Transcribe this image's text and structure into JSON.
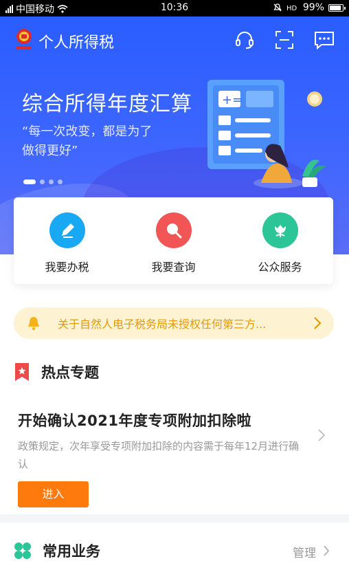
{
  "status_bar": {
    "carrier": "中国移动",
    "time": "10:36",
    "battery": "99%"
  },
  "header": {
    "app_title": "个人所得税",
    "logo_icon": "tax-emblem-icon",
    "buttons": [
      "headset-icon",
      "scan-icon",
      "message-icon"
    ]
  },
  "banner": {
    "title": "综合所得年度汇算",
    "subtitle_line1": "“每一次改变，都是为了",
    "subtitle_line2": "做得更好”",
    "slides": 4,
    "active_slide": 1
  },
  "quick_actions": [
    {
      "label": "我要办税",
      "icon": "pencil-icon",
      "color": "#19a8f4"
    },
    {
      "label": "我要查询",
      "icon": "search-icon",
      "color": "#f25555"
    },
    {
      "label": "公众服务",
      "icon": "tulip-icon",
      "color": "#2cc597"
    }
  ],
  "notice": {
    "text": "关于自然人电子税务局未授权任何第三方...",
    "color": "#e59a00",
    "background": "#fdf3d3"
  },
  "hot_topics": {
    "title": "热点专题",
    "topic": {
      "title": "开始确认2021年度专项附加扣除啦",
      "description": "政策规定，次年享受专项附加扣除的内容需于每年12月进行确认",
      "button": "进入"
    }
  },
  "common_services": {
    "title": "常用业务",
    "manage": "管理"
  },
  "colors": {
    "brand_blue": "#2a5dff",
    "accent_orange": "#ff7a0c"
  }
}
